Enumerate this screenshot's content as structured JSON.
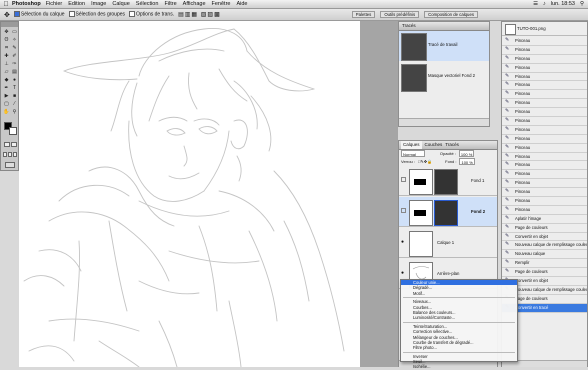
{
  "menubar": {
    "apple": "",
    "app": "Photoshop",
    "items": [
      "Fichier",
      "Edition",
      "Image",
      "Calque",
      "Sélection",
      "Filtre",
      "Affichage",
      "Fenêtre",
      "Aide"
    ],
    "clock": "lun. 18:53"
  },
  "options": {
    "opt1": "Sélection du calque",
    "opt2": "Sélection des groupes",
    "opt3": "Options de trans.",
    "tab1": "Palettes",
    "tab2": "Outils prédéfinis",
    "tab3": "Composition de calques"
  },
  "traces": {
    "title": "Tracés",
    "items": [
      {
        "label": "Tracé de travail"
      },
      {
        "label": "Masque vectoriel Fond 2"
      }
    ]
  },
  "layers": {
    "tabs": [
      "Calques",
      "Couches",
      "Tracés"
    ],
    "mode": "Normal",
    "opacity_label": "Opacité :",
    "opacity": "100 %",
    "lock_label": "Verrou :",
    "fill_label": "Fond :",
    "fill": "100 %",
    "items": [
      {
        "label": "Fond 1"
      },
      {
        "label": "Fond 2"
      },
      {
        "label": "Calque 1"
      },
      {
        "label": "Arrière-plan"
      }
    ]
  },
  "history": {
    "doc": "TUTO-001.png",
    "items": [
      "Pinceau",
      "Pinceau",
      "Pinceau",
      "Pinceau",
      "Pinceau",
      "Pinceau",
      "Pinceau",
      "Pinceau",
      "Pinceau",
      "Pinceau",
      "Pinceau",
      "Pinceau",
      "Pinceau",
      "Pinceau",
      "Pinceau",
      "Pinceau",
      "Pinceau",
      "Pinceau",
      "Pinceau",
      "Pinceau",
      "Aplatir l'image",
      "Page de couleurs",
      "Convertir en objet",
      "Nouveau calque de remplissage couleur",
      "Nouveau calque",
      "Remplir",
      "Page de couleurs",
      "Convertir en objet",
      "Nouveau calque de remplissage couleur",
      "Page de couleurs",
      "Convertir en tracé"
    ]
  },
  "context_menu": {
    "items": [
      "Couleur unie...",
      "Dégradé...",
      "Motif...",
      "---",
      "Niveaux...",
      "Courbes...",
      "Balance des couleurs...",
      "Luminosité/Contraste...",
      "---",
      "Teinte/Saturation...",
      "Correction sélective...",
      "Mélangeur de couches...",
      "Courbe de transfert de dégradé...",
      "Filtre photo...",
      "---",
      "Inverser",
      "Seuil...",
      "Isohélie..."
    ]
  },
  "colors": {
    "selection": "#3a7ae0"
  }
}
